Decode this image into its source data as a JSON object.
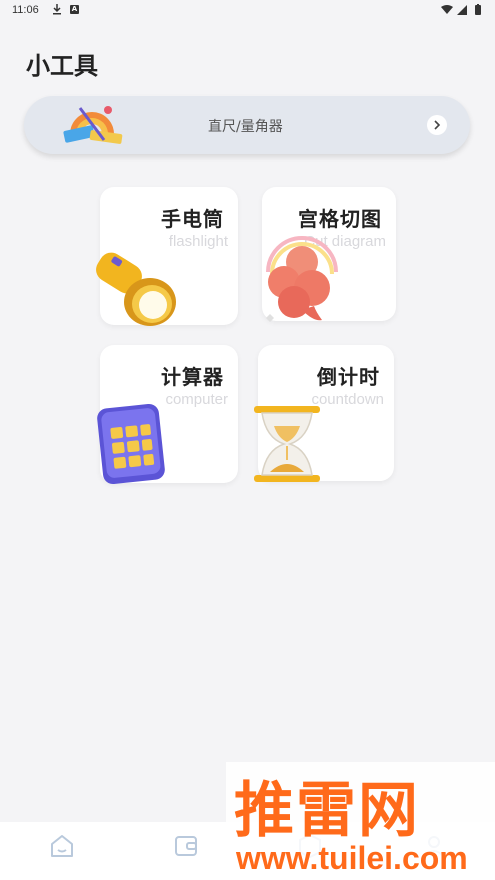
{
  "status_bar": {
    "time": "11:06",
    "a_badge": "A"
  },
  "page": {
    "title": "小工具"
  },
  "ruler_banner": {
    "label": "直尺/量角器"
  },
  "tools": [
    {
      "title": "手电筒",
      "subtitle": "flashlight",
      "icon": "flashlight-icon"
    },
    {
      "title": "宫格切图",
      "subtitle": "Cut diagram",
      "icon": "cloud-rainbow-icon"
    },
    {
      "title": "计算器",
      "subtitle": "computer",
      "icon": "calculator-icon"
    },
    {
      "title": "倒计时",
      "subtitle": "countdown",
      "icon": "hourglass-icon"
    }
  ],
  "watermark": {
    "brand": "推雷网",
    "url": "www.tuilei.com"
  },
  "bottom_nav": [
    {
      "icon": "home-icon"
    },
    {
      "icon": "wallet-icon"
    },
    {
      "icon": "box-icon"
    },
    {
      "icon": "profile-icon"
    }
  ],
  "colors": {
    "accent": "#ff6a1a",
    "card_bg": "#ffffff",
    "page_bg": "#f4f4f6",
    "banner_bg": "#e3e7ee"
  }
}
